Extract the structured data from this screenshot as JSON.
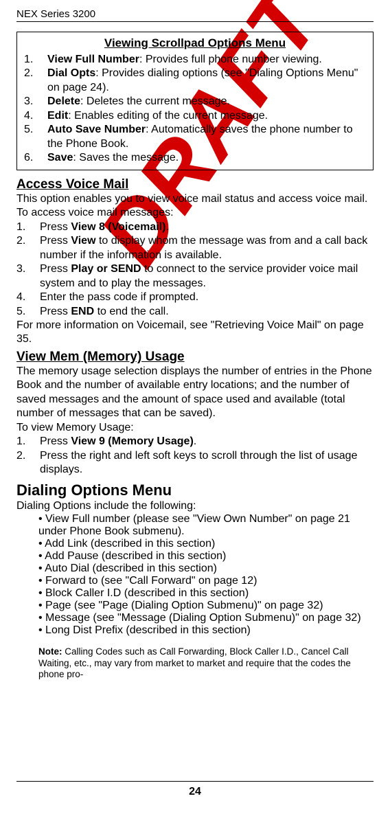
{
  "header": "NEX Series 3200",
  "watermark": "DRAFT",
  "page_number": "24",
  "box": {
    "title": "Viewing Scrollpad Options Menu",
    "items": [
      {
        "n": "1.",
        "label": "View Full Number",
        "desc": ":  Provides full phone number viewing."
      },
      {
        "n": "2.",
        "label": "Dial Opts",
        "desc": ":  Provides dialing options (see \"Dialing Options Menu\" on page 24)."
      },
      {
        "n": "3.",
        "label": "Delete",
        "desc": ":  Deletes the current message."
      },
      {
        "n": "4.",
        "label": "Edit",
        "desc": ":  Enables editing of the current message."
      },
      {
        "n": "5.",
        "label": "Auto Save Number",
        "desc": ":  Automatically saves the phone number to the Phone Book."
      },
      {
        "n": "6.",
        "label": "Save",
        "desc": ":  Saves the message."
      }
    ]
  },
  "s1": {
    "title": "Access Voice Mail",
    "p1": "This option enables you to view voice mail status and access voice mail.",
    "p2": "To access voice mail messages:",
    "steps": [
      {
        "n": "1.",
        "pre": "Press ",
        "b": "View 8 (Voicemail)",
        "post": "."
      },
      {
        "n": "2.",
        "pre": "Press ",
        "b": "View",
        "post": " to display whom the message was from and a call back number if the information is available."
      },
      {
        "n": "3.",
        "pre": "Press ",
        "b": "Play or SEND",
        "post": " to connect to the service provider voice mail system and to play the messages."
      },
      {
        "n": "4.",
        "pre": "Enter the pass code if prompted.",
        "b": "",
        "post": ""
      },
      {
        "n": "5.",
        "pre": "Press ",
        "b": "END",
        "post": " to end the call."
      }
    ],
    "p3": "For more information on Voicemail, see \"Retrieving Voice Mail\" on page 35."
  },
  "s2": {
    "title": "View Mem (Memory) Usage",
    "p1": "The memory usage selection displays the number of entries in the Phone Book and the number of available entry locations; and the number of saved messages and the amount of space used and available (total number of messages that can be saved).",
    "p2": "To view Memory Usage:",
    "steps": [
      {
        "n": "1.",
        "pre": "Press ",
        "b": "View 9 (Memory Usage)",
        "post": "."
      },
      {
        "n": "2.",
        "pre": "Press the right and left soft keys to scroll through the list of usage displays.",
        "b": "",
        "post": ""
      }
    ]
  },
  "s3": {
    "title": "Dialing Options Menu",
    "p1": "Dialing Options include the following:",
    "bullets": [
      "View Full number (please see \"View Own Number\" on page 21 under Phone Book submenu).",
      "Add Link (described in this section)",
      "Add Pause (described in this section)",
      "Auto Dial (described in this section)",
      "Forward to (see \"Call Forward\" on page 12)",
      "Block Caller I.D (described in this section)",
      "Page (see \"Page (Dialing Option Submenu)\" on page 32)",
      "Message (see \"Message (Dialing Option Submenu)\" on page 32)",
      "Long Dist Prefix (described in this section)"
    ],
    "note_label": "Note:  ",
    "note_text": "Calling Codes such as Call Forwarding, Block Caller I.D., Cancel Call Waiting, etc., may vary from market to market and require that the codes the phone pro-"
  }
}
